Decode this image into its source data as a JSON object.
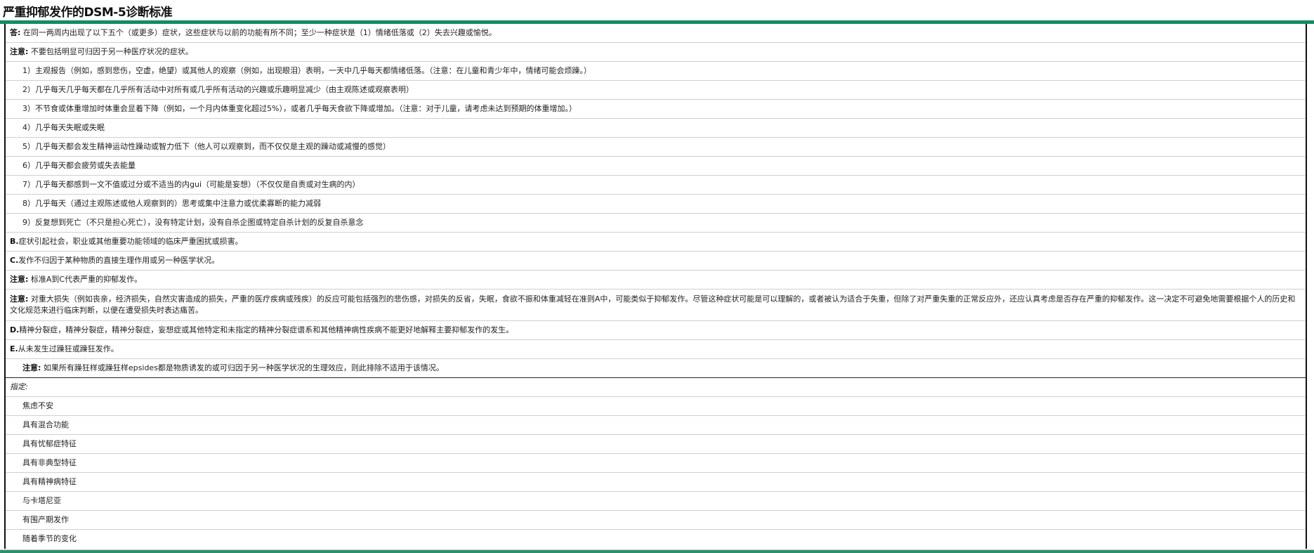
{
  "title": "严重抑郁发作的DSM-5诊断标准",
  "colors": {
    "accent": "#0e8f60"
  },
  "criteria": {
    "a": {
      "label": "答:",
      "text": "在同一两周内出现了以下五个（或更多）症状，这些症状与以前的功能有所不同；至少一种症状是（1）情绪低落或（2）失去兴趣或愉悦。"
    },
    "note1": {
      "label": "注意:",
      "text": "不要包括明显可归因于另一种医疗状况的症状。"
    },
    "items": [
      "1）主观报告（例如，感到悲伤，空虚，绝望）或其他人的观察（例如，出现眼泪）表明，一天中几乎每天都情绪低落。（注意：在儿童和青少年中，情绪可能会烦躁。）",
      "2）几乎每天几乎每天都在几乎所有活动中对所有或几乎所有活动的兴趣或乐趣明显减少（由主观陈述或观察表明）",
      "3）不节食或体重增加时体重会显着下降（例如，一个月内体重变化超过5%），或者几乎每天食欲下降或增加。（注意：对于儿童，请考虑未达到预期的体重增加。）",
      "4）几乎每天失眠或失眠",
      "5）几乎每天都会发生精神运动性躁动或智力低下（他人可以观察到，而不仅仅是主观的躁动或减慢的感觉）",
      "6）几乎每天都会疲劳或失去能量",
      "7）几乎每天都感到一文不值或过分或不适当的内gui（可能是妄想）（不仅仅是自责或对生病的内）",
      "8）几乎每天（通过主观陈述或他人观察到的）思考或集中注意力或优柔寡断的能力减弱",
      "9）反复想到死亡（不只是担心死亡），没有特定计划，没有自杀企图或特定自杀计划的反复自杀意念"
    ],
    "b": {
      "label": "B.",
      "text": "症状引起社会，职业或其他重要功能领域的临床严重困扰或损害。"
    },
    "c": {
      "label": "C.",
      "text": "发作不归因于某种物质的直接生理作用或另一种医学状况。"
    },
    "note2": {
      "label": "注意:",
      "text": "标准A到C代表严重的抑郁发作。"
    },
    "note3": {
      "label": "注意:",
      "text": "对重大损失（例如丧亲，经济损失，自然灾害造成的损失，严重的医疗疾病或残疾）的反应可能包括强烈的悲伤感，对损失的反省，失眠，食欲不振和体重减轻在准则A中，可能类似于抑郁发作。尽管这种症状可能是可以理解的，或者被认为适合于失重，但除了对严重失重的正常反应外，还应认真考虑是否存在严重的抑郁发作。这一决定不可避免地需要根据个人的历史和文化规范来进行临床判断，以便在遭受损失时表达痛苦。"
    },
    "d": {
      "label": "D.",
      "text": "精神分裂症，精神分裂症，精神分裂症，妄想症或其他特定和未指定的精神分裂症谱系和其他精神病性疾病不能更好地解释主要抑郁发作的发生。"
    },
    "e": {
      "label": "E.",
      "text": "从未发生过躁狂或躁狂发作。"
    },
    "note4": {
      "label": "注意:",
      "text": "如果所有躁狂样或躁狂样epsides都是物质诱发的或可归因于另一种医学状况的生理效应，则此排除不适用于该情况。"
    }
  },
  "specifiers": {
    "heading": "指定:",
    "items": [
      "焦虑不安",
      "具有混合功能",
      "具有忧郁症特征",
      "具有非典型特征",
      "具有精神病特征",
      "与卡塔尼亚",
      "有围产期发作",
      "随着季节的变化"
    ]
  }
}
